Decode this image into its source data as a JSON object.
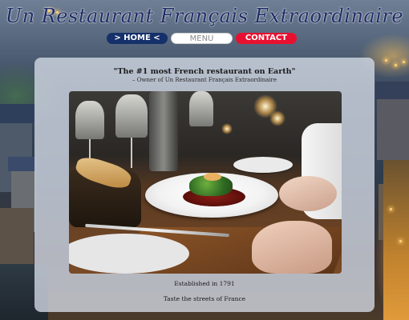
{
  "site": {
    "title": "Un Restaurant Français Extraordinaire"
  },
  "nav": {
    "home_label": "> HOME <",
    "menu_label": "MENU",
    "contact_label": "CONTACT"
  },
  "hero": {
    "quote": "\"The #1 most French restaurant on Earth\"",
    "attribution": "– Owner of Un Restaurant Français Extraordinaire",
    "photo_description_icon": "restaurant-photo"
  },
  "footer": {
    "established": "Established in 1791",
    "tagline": "Taste the streets of France"
  },
  "colors": {
    "title": "#1e2a66",
    "home_button": "#15306a",
    "menu_button": "#ffffff",
    "contact_button": "#e81030"
  }
}
